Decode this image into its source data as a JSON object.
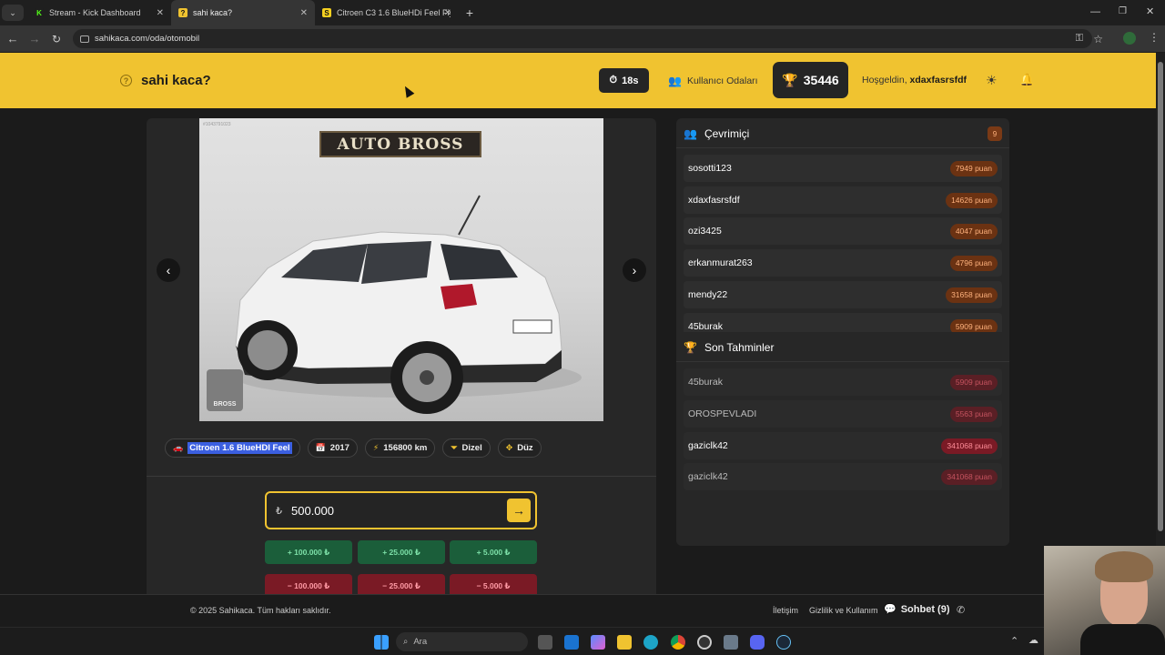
{
  "browser": {
    "tabs": [
      {
        "title": "Stream - Kick Dashboard",
        "icon": "kick-icon",
        "color": "#53fc18"
      },
      {
        "title": "sahi kaca?",
        "icon": "question-icon",
        "color": "#f0c330"
      },
      {
        "title": "Citroen C3 1.6 BlueHDi Feel Fiy",
        "icon": "s-icon",
        "color": "#f5d020"
      }
    ],
    "url": "sahikaca.com/oda/otomobil"
  },
  "header": {
    "brand": "sahi kaca?",
    "timer": "18s",
    "rooms_label": "Kullanıcı Odaları",
    "score": "35446",
    "welcome_prefix": "Hoşgeldin,",
    "username": "xdaxfasrsfdf",
    "accent": "#f0c330"
  },
  "listing": {
    "photo_logo": "AUTO BROSS",
    "photo_watermark": "BROSS",
    "photo_id": "#1043791023",
    "model": "Citroen 1.6 BlueHDI Feel",
    "year": "2017",
    "km": "156800 km",
    "fuel": "Dizel",
    "gear": "Düz"
  },
  "guess": {
    "currency": "₺",
    "value": "500.000",
    "plus": [
      "+ 100.000 ₺",
      "+ 25.000 ₺",
      "+ 5.000 ₺"
    ],
    "minus": [
      "− 100.000 ₺",
      "− 25.000 ₺",
      "− 5.000 ₺"
    ]
  },
  "online": {
    "title": "Çevrimiçi",
    "count": "9",
    "users": [
      {
        "name": "sosotti123",
        "points": "7949 puan"
      },
      {
        "name": "xdaxfasrsfdf",
        "points": "14626 puan"
      },
      {
        "name": "ozi3425",
        "points": "4047 puan"
      },
      {
        "name": "erkanmurat263",
        "points": "4796 puan"
      },
      {
        "name": "mendy22",
        "points": "31658 puan"
      },
      {
        "name": "45burak",
        "points": "5909 puan"
      }
    ]
  },
  "predictions": {
    "title": "Son Tahminler",
    "items": [
      {
        "name": "45burak",
        "points": "5909 puan"
      },
      {
        "name": "OROSPEVLADI",
        "points": "5563 puan"
      },
      {
        "name": "gaziclk42",
        "points": "341068 puan"
      },
      {
        "name": "gaziclk42",
        "points": "341068 puan"
      }
    ]
  },
  "footer": {
    "copyright": "© 2025 Sahikaca. Tüm hakları saklıdır.",
    "contact": "İletişim",
    "privacy": "Gizlilik ve Kullanım",
    "chat": "Sohbet (9)"
  },
  "taskbar": {
    "search_placeholder": "Ara"
  }
}
